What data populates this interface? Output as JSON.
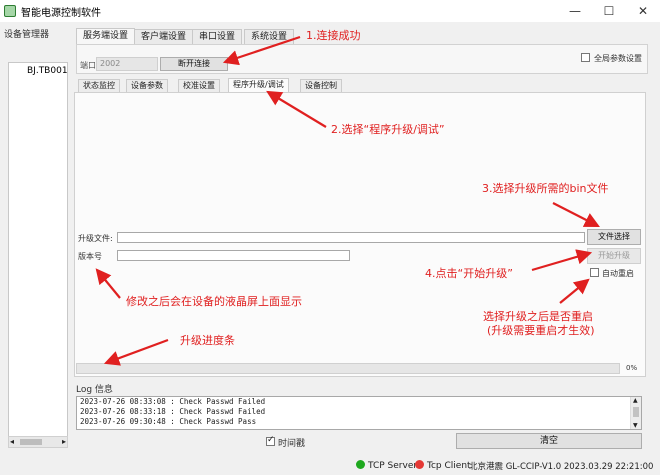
{
  "window": {
    "title": "智能电源控制软件",
    "minimize": "—",
    "maximize": "☐",
    "close": "✕"
  },
  "sidebar": {
    "label": "设备管理器",
    "items": [
      "BJ.TB001"
    ]
  },
  "top_tabs": [
    "服务端设置",
    "客户端设置",
    "串口设置",
    "系统设置"
  ],
  "server": {
    "port_label": "端口",
    "port_value": "2002",
    "disconnect_button": "断开连接",
    "global_params_label": "全局参数设置",
    "global_params_checked": false
  },
  "sub_tabs": [
    "状态监控",
    "设备参数",
    "校准设置",
    "程序升级/调试",
    "设备控制"
  ],
  "upgrade": {
    "file_label": "升级文件:",
    "file_value": "",
    "file_select_button": "文件选择",
    "version_label": "版本号",
    "version_value": "",
    "start_upgrade_button": "开始升级",
    "auto_restart_label": "自动重启",
    "auto_restart_checked": false,
    "progress": 0,
    "progress_text": "0%"
  },
  "log": {
    "label": "Log 信息",
    "lines": [
      "2023-07-26 08:33:08 : Check Passwd Failed",
      "2023-07-26 08:33:18 : Check Passwd Failed",
      "2023-07-26 09:30:48 : Check Passwd Pass"
    ],
    "timestamp_label": "时间戳",
    "timestamp_checked": true,
    "clear_button": "清空"
  },
  "status": {
    "server_label": "TCP Server",
    "client_label": "Tcp Client",
    "info": "北京港震 GL-CCIP-V1.0 2023.03.29 22:21:00",
    "server_color": "#1ea81e",
    "client_color": "#e53935"
  },
  "annotations": {
    "color": "#e02020",
    "step1": "1.连接成功",
    "step2": "2.选择“程序升级/调试”",
    "step3": "3.选择升级所需的bin文件",
    "step4": "4.点击“开始升级”",
    "version_note": "修改之后会在设备的液晶屏上面显示",
    "progress_note": "升级进度条",
    "restart_note_1": "选择升级之后是否重启",
    "restart_note_2": "(升级需要重启才生效)"
  }
}
